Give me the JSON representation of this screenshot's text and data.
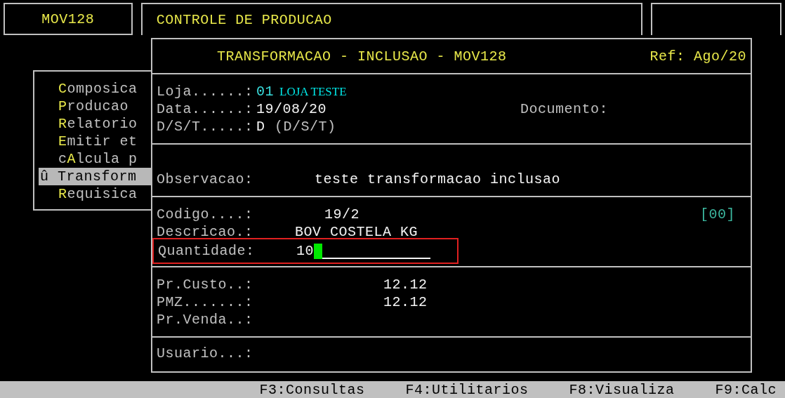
{
  "header": {
    "program": "MOV128",
    "system": "CONTROLE DE PRODUCAO"
  },
  "menu": {
    "items": [
      {
        "text": "**C**omposica",
        "selected": false
      },
      {
        "text": "**P**roducao",
        "selected": false
      },
      {
        "text": "**R**elatorio",
        "selected": false
      },
      {
        "text": "**E**mitir et",
        "selected": false
      },
      {
        "text": "c**A**lcula p",
        "selected": false
      },
      {
        "text": "û Transform",
        "selected": true
      },
      {
        "text": "**R**equisica",
        "selected": false
      }
    ]
  },
  "dialog": {
    "title": "TRANSFORMACAO - INCLUSAO - MOV128",
    "ref": "Ref: Ago/20",
    "loja": {
      "label": "Loja......:",
      "code": "01",
      "name": "LOJA TESTE"
    },
    "data": {
      "label": "Data......:",
      "value": "19/08/20"
    },
    "documento": {
      "label": "Documento:"
    },
    "dst": {
      "label": "D/S/T.....:",
      "value": "D",
      "hint": "(D/S/T)"
    },
    "observacao": {
      "label": "Observacao:",
      "value": "teste transformacao inclusao"
    },
    "codigo": {
      "label": "Codigo....:",
      "value": "19/2",
      "tag": "[00]"
    },
    "descricao": {
      "label": "Descricao.:",
      "value": "BOV COSTELA KG"
    },
    "quantidade": {
      "label": "Quantidade:",
      "value": "10",
      "highlighted": true
    },
    "precos": [
      {
        "label": "Pr.Custo..:",
        "value": "12.12"
      },
      {
        "label": "PMZ.......:",
        "value": "12.12"
      },
      {
        "label": "Pr.Venda..:"
      }
    ],
    "usuario": {
      "label": "Usuario...:"
    }
  },
  "status_bar": [
    "F3:Consultas",
    "F4:Utilitarios",
    "F8:Visualiza",
    "F9:Calc"
  ]
}
